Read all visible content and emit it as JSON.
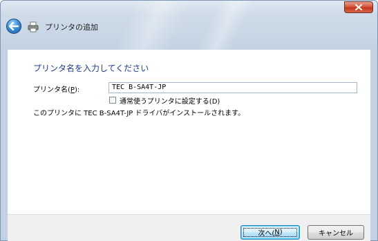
{
  "window": {
    "title": "プリンタの追加"
  },
  "heading": "プリンタ名を入力してください",
  "printer_name": {
    "label_text": "プリンタ名(",
    "label_accel": "P",
    "label_end": "):",
    "value": "TEC B-SA4T-JP"
  },
  "default_checkbox": {
    "label": "通常使うプリンタに設定する(D)",
    "checked": false
  },
  "info_text": "このプリンタに TEC B-SA4T-JP ドライバがインストールされます。",
  "buttons": {
    "next_text": "次へ(",
    "next_accel": "N",
    "next_end": ")",
    "cancel": "キャンセル"
  },
  "icons": {
    "back": "back-arrow-icon",
    "printer": "printer-icon",
    "close": "close-icon"
  }
}
